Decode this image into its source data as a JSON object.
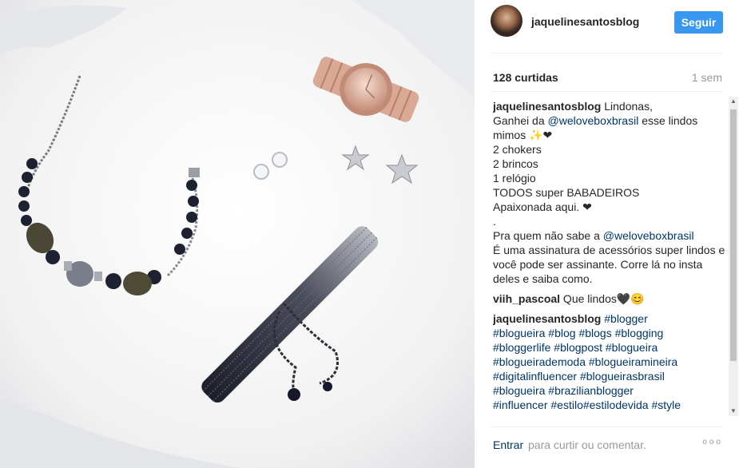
{
  "header": {
    "username": "jaquelinesantosblog",
    "follow_label": "Seguir"
  },
  "stats": {
    "likes": "128 curtidas",
    "time_ago": "1 sem"
  },
  "icons": {
    "avatar": "profile-photo",
    "more": "more-options-icon",
    "scroll_up": "arrow-up-icon",
    "scroll_down": "arrow-down-icon"
  },
  "colors": {
    "follow_button": "#3897f0",
    "link": "#003569"
  },
  "comments": [
    {
      "user": "jaquelinesantosblog",
      "parts": [
        {
          "t": " Lindonas,\nGanhei da "
        },
        {
          "t": "@weloveboxbrasil",
          "tag": true
        },
        {
          "t": " esse lindos mimos ✨❤\n2 chokers\n2 brincos\n1 relógio\nTODOS super BABADEIROS\nApaixonada aqui. ❤\n.\nPra quem não sabe a "
        },
        {
          "t": "@weloveboxbrasil",
          "tag": true
        },
        {
          "t": "\nÉ uma assinatura de acessórios super lindos e você pode ser assinante. Corre lá no insta deles e saiba como."
        }
      ]
    },
    {
      "user": "viih_pascoal",
      "parts": [
        {
          "t": " Que lindos🖤😊"
        }
      ]
    },
    {
      "user": "jaquelinesantosblog",
      "parts": [
        {
          "t": " "
        },
        {
          "t": "#blogger",
          "tag": true
        },
        {
          "t": "\n"
        },
        {
          "t": "#blogueira",
          "tag": true
        },
        {
          "t": " "
        },
        {
          "t": "#blog",
          "tag": true
        },
        {
          "t": " "
        },
        {
          "t": "#blogs",
          "tag": true
        },
        {
          "t": " "
        },
        {
          "t": "#blogging",
          "tag": true
        },
        {
          "t": "\n"
        },
        {
          "t": "#bloggerlife",
          "tag": true
        },
        {
          "t": " "
        },
        {
          "t": "#blogpost",
          "tag": true
        },
        {
          "t": " "
        },
        {
          "t": "#blogueira",
          "tag": true
        },
        {
          "t": "\n"
        },
        {
          "t": "#blogueirademoda",
          "tag": true
        },
        {
          "t": " "
        },
        {
          "t": "#blogueiramineira",
          "tag": true
        },
        {
          "t": "\n"
        },
        {
          "t": "#digitalinfluencer",
          "tag": true
        },
        {
          "t": " "
        },
        {
          "t": "#blogueirasbrasil",
          "tag": true
        },
        {
          "t": "\n"
        },
        {
          "t": "#blogueira",
          "tag": true
        },
        {
          "t": " "
        },
        {
          "t": "#brazilianblogger",
          "tag": true
        },
        {
          "t": "\n"
        },
        {
          "t": "#influencer",
          "tag": true
        },
        {
          "t": " "
        },
        {
          "t": "#estilo",
          "tag": true
        },
        {
          "t": "#estilodevida",
          "tag": true
        },
        {
          "t": " "
        },
        {
          "t": "#style",
          "tag": true
        }
      ]
    }
  ],
  "footer": {
    "login_link": "Entrar",
    "prompt": "para curtir ou comentar.",
    "more": "ooo"
  }
}
